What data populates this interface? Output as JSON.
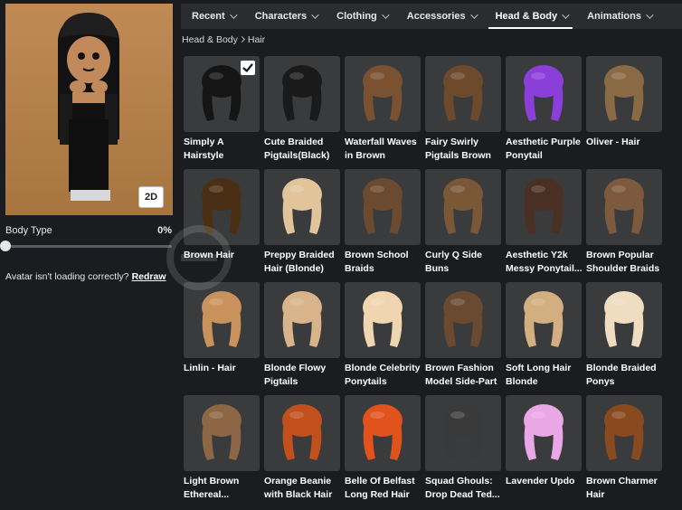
{
  "tabs": [
    {
      "label": "Recent"
    },
    {
      "label": "Characters"
    },
    {
      "label": "Clothing"
    },
    {
      "label": "Accessories"
    },
    {
      "label": "Head & Body"
    },
    {
      "label": "Animations"
    }
  ],
  "breadcrumb": {
    "parent": "Head & Body",
    "current": "Hair"
  },
  "preview": {
    "view_button": "2D"
  },
  "body_type": {
    "label": "Body Type",
    "value": "0%"
  },
  "loading": {
    "message": "Avatar isn't loading correctly?",
    "redraw": "Redraw"
  },
  "items": [
    {
      "name": "Simply A Hairstyle",
      "color": "#151515",
      "equipped": true
    },
    {
      "name": "Cute Braided Pigtails(Black)",
      "color": "#1a1a1a"
    },
    {
      "name": "Waterfall Waves in Brown",
      "color": "#7a5232"
    },
    {
      "name": "Fairy Swirly Pigtails Brown",
      "color": "#6e4a2c"
    },
    {
      "name": "Aesthetic Purple Ponytail",
      "color": "#8b3fd9"
    },
    {
      "name": "Oliver - Hair",
      "color": "#8a6a45"
    },
    {
      "name": "Brown Hair",
      "color": "#4a2f14"
    },
    {
      "name": "Preppy Braided Hair (Blonde)",
      "color": "#e2c49a"
    },
    {
      "name": "Brown School Braids",
      "color": "#6b4a30"
    },
    {
      "name": "Curly Q Side Buns",
      "color": "#7a5737"
    },
    {
      "name": "Aesthetic Y2k Messy Ponytail...",
      "color": "#4a3022"
    },
    {
      "name": "Brown Popular Shoulder Braids",
      "color": "#7d5a3e"
    },
    {
      "name": "Linlin - Hair",
      "color": "#c9925c"
    },
    {
      "name": "Blonde Flowy Pigtails",
      "color": "#d9b48a"
    },
    {
      "name": "Blonde Celebrity Ponytails",
      "color": "#efd6b0"
    },
    {
      "name": "Brown Fashion Model Side-Part",
      "color": "#6a4a30"
    },
    {
      "name": "Soft Long Hair Blonde",
      "color": "#d2ae80"
    },
    {
      "name": "Blonde Braided Ponys",
      "color": "#f0dcc0"
    },
    {
      "name": "Light Brown Ethereal...",
      "color": "#8d6645"
    },
    {
      "name": "Orange Beanie with Black Hair",
      "color": "#c2501c"
    },
    {
      "name": "Belle Of Belfast Long Red Hair",
      "color": "#e2521c"
    },
    {
      "name": "Squad Ghouls: Drop Dead Ted...",
      "color": "#3a3a3a"
    },
    {
      "name": "Lavender Updo",
      "color": "#e9a7e6"
    },
    {
      "name": "Brown Charmer Hair",
      "color": "#8a4a20"
    }
  ]
}
